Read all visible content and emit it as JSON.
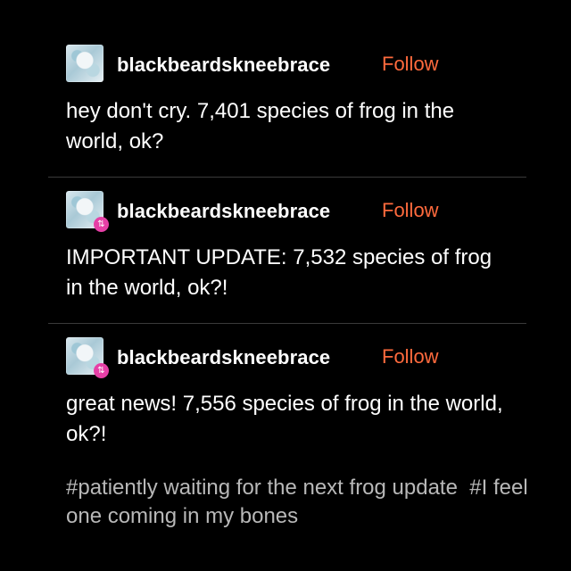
{
  "posts": [
    {
      "username": "blackbeardskneebrace",
      "follow_label": "Follow",
      "text": "hey don't cry. 7,401 species of frog in the world, ok?",
      "reblog": false
    },
    {
      "username": "blackbeardskneebrace",
      "follow_label": "Follow",
      "text": "IMPORTANT UPDATE: 7,532 species of frog in the world, ok?!",
      "reblog": true
    },
    {
      "username": "blackbeardskneebrace",
      "follow_label": "Follow",
      "text": "great news! 7,556 species of frog in the world, ok?!",
      "reblog": true
    }
  ],
  "tags": [
    "#patiently waiting for the next frog update",
    "#I feel one coming in my bones"
  ],
  "colors": {
    "background": "#000000",
    "text": "#ffffff",
    "follow": "#ff6a3d",
    "tags": "#b8b8b8",
    "reblog_badge": "#e63fa6"
  },
  "icons": {
    "reblog_badge": "reblog-icon"
  }
}
